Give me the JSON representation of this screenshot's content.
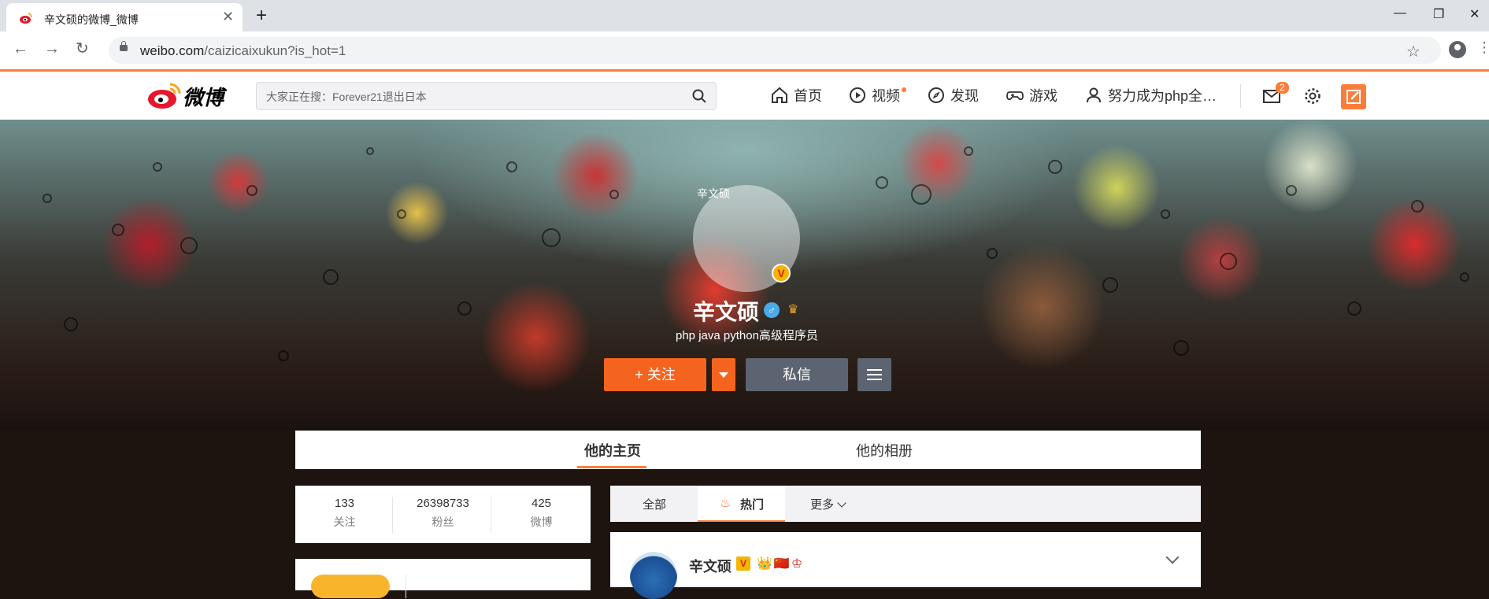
{
  "browser": {
    "tab_title": "辛文硕的微博_微博",
    "url_host": "weibo.com",
    "url_path": "/caizicaixukun?is_hot=1"
  },
  "header": {
    "logo_text": "微博",
    "search_placeholder": "大家正在搜：Forever21退出日本",
    "nav": [
      {
        "label": "首页",
        "icon": "home-icon"
      },
      {
        "label": "视频",
        "icon": "video-icon"
      },
      {
        "label": "发现",
        "icon": "compass-icon"
      },
      {
        "label": "游戏",
        "icon": "gamepad-icon"
      },
      {
        "label": "努力成为php全…",
        "icon": "user-icon"
      }
    ],
    "message_count": "2",
    "accent_color": "#fa7d3c"
  },
  "profile": {
    "avatar_alt": "辛文硕",
    "verify_glyph": "V",
    "name": "辛文硕",
    "gender_glyph": "♂",
    "bio": "php java python高级程序员",
    "follow_label": "+ 关注",
    "message_label": "私信"
  },
  "page_tabs": [
    {
      "label": "他的主页",
      "active": true
    },
    {
      "label": "他的相册",
      "active": false
    }
  ],
  "stats": [
    {
      "value": "133",
      "label": "关注"
    },
    {
      "value": "26398733",
      "label": "粉丝"
    },
    {
      "value": "425",
      "label": "微博"
    }
  ],
  "feed_filter": {
    "all": "全部",
    "hot": "热门",
    "more": "更多"
  },
  "post": {
    "author": "辛文硕",
    "verify_glyph": "V",
    "badges": "👑🇨🇳♔"
  }
}
